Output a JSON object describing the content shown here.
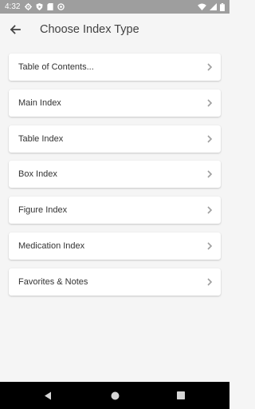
{
  "status_bar": {
    "time": "4:32",
    "left_icons": [
      "gear-icon",
      "shield-play-icon",
      "sim-icon",
      "at-icon"
    ],
    "right_icons": [
      "wifi-icon",
      "signal-icon",
      "battery-icon"
    ]
  },
  "app_bar": {
    "title": "Choose Index Type",
    "back_icon": "arrow-back-icon"
  },
  "index_types": [
    {
      "label": "Table of Contents..."
    },
    {
      "label": "Main Index"
    },
    {
      "label": "Table Index"
    },
    {
      "label": "Box Index"
    },
    {
      "label": "Figure Index"
    },
    {
      "label": "Medication Index"
    },
    {
      "label": "Favorites & Notes"
    }
  ],
  "nav_bar": {
    "buttons": [
      "back-triangle-icon",
      "home-circle-icon",
      "recents-square-icon"
    ]
  },
  "colors": {
    "background": "#f5f5f5",
    "status_bar": "#9e9e9e",
    "card": "#ffffff",
    "text": "#333333",
    "chevron": "#9e9e9e",
    "nav_bar": "#000000"
  }
}
